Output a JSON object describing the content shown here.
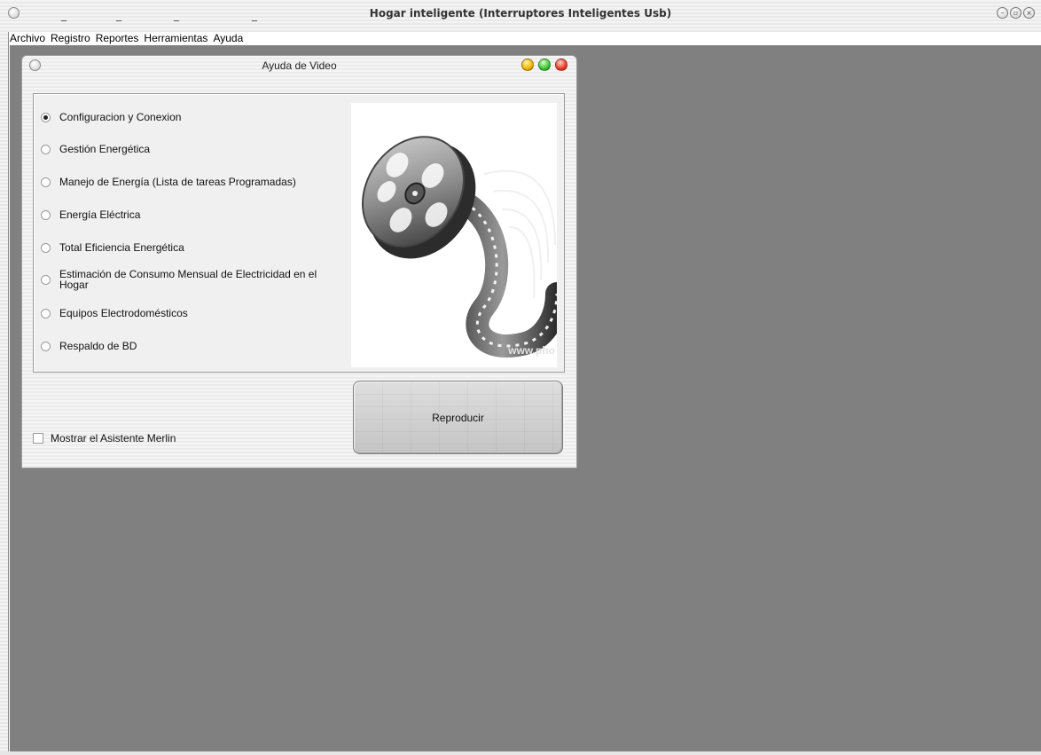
{
  "main_window": {
    "title": "Hogar inteligente (Interruptores Inteligentes Usb)",
    "title_dashes": [
      "_",
      "_",
      "_",
      "_"
    ],
    "controls": {
      "minimize": "–",
      "restore": "▫",
      "close": "×"
    }
  },
  "menu": {
    "items": [
      {
        "label": "Archivo"
      },
      {
        "label": "Registro"
      },
      {
        "label": "Reportes"
      },
      {
        "label": "Herramientas"
      },
      {
        "label": "Ayuda"
      }
    ]
  },
  "dialog": {
    "title": "Ayuda de Video",
    "options": [
      {
        "label": "Configuracion y Conexion",
        "checked": true
      },
      {
        "label": "Gestión Energética",
        "checked": false
      },
      {
        "label": "Manejo de Energía (Lista de tareas Programadas)",
        "checked": false
      },
      {
        "label": "Energía Eléctrica",
        "checked": false
      },
      {
        "label": "Total Eficiencia Energética",
        "checked": false
      },
      {
        "label": "Estimación de Consumo Mensual de Electricidad en el Hogar",
        "checked": false
      },
      {
        "label": "Equipos Electrodomésticos",
        "checked": false
      },
      {
        "label": "Respaldo de BD",
        "checked": false
      }
    ],
    "image_watermark": "www.pho",
    "play_button": "Reproducir",
    "merlin_checkbox": {
      "label": "Mostrar el Asistente Merlin",
      "checked": false
    }
  },
  "colors": {
    "client_area": "#808080",
    "light_yellow": "#f0b400",
    "light_green": "#3ec33a",
    "light_red": "#ee3a2a"
  },
  "icons": {
    "film_reel": "film-reel-icon"
  }
}
